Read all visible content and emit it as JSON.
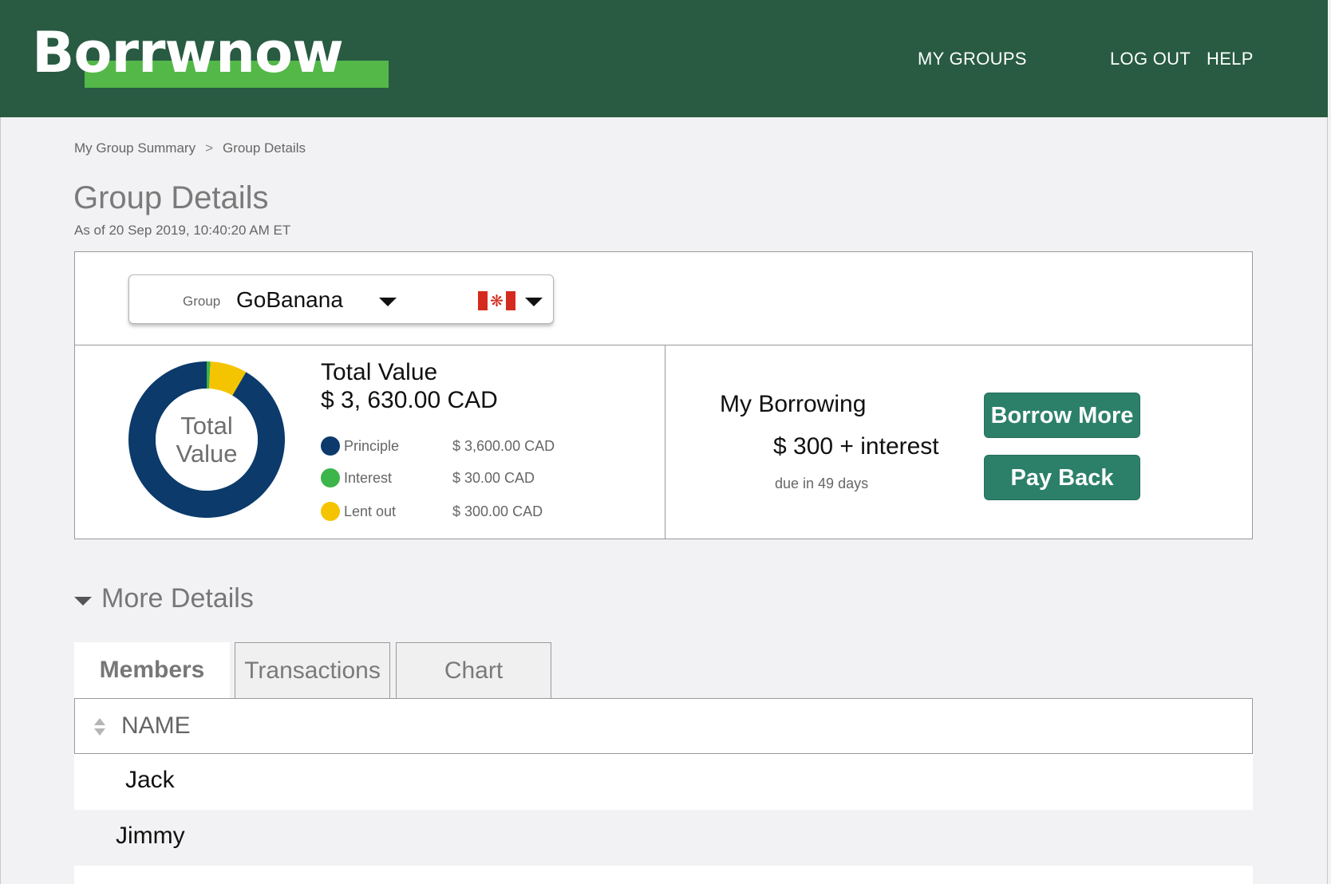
{
  "app": {
    "logo_text": "Borrwnow"
  },
  "nav": {
    "my_groups": "MY GROUPS",
    "log_out": "LOG OUT",
    "help": "HELP"
  },
  "breadcrumb": {
    "items": [
      "My Group Summary",
      "Group Details"
    ],
    "separator": ">"
  },
  "page": {
    "title": "Group Details",
    "timestamp": "As of 20 Sep 2019, 10:40:20 AM ET"
  },
  "group_selector": {
    "label": "Group",
    "value": "GoBanana",
    "country_flag": "canada-flag-icon"
  },
  "total_value": {
    "title": "Total Value",
    "amount": "$ 3, 630.00 CAD",
    "center_line1": "Total",
    "center_line2": "Value",
    "legend": [
      {
        "label": "Principle",
        "value": "$ 3,600.00 CAD",
        "color": "#0b3a6b"
      },
      {
        "label": "Interest",
        "value": "$ 30.00 CAD",
        "color": "#3cb54a"
      },
      {
        "label": "Lent out",
        "value": "$ 300.00 CAD",
        "color": "#f5c400"
      }
    ]
  },
  "chart_data": {
    "type": "pie",
    "categories": [
      "Interest",
      "Lent out",
      "Principle"
    ],
    "values": [
      30,
      300,
      3600
    ],
    "colors": [
      "#3cb54a",
      "#f5c400",
      "#0b3a6b"
    ],
    "style": "donut"
  },
  "borrowing": {
    "title": "My Borrowing",
    "amount": "$ 300 + interest",
    "due": "due in 49 days",
    "borrow_more_label": "Borrow More",
    "pay_back_label": "Pay Back"
  },
  "more_details": {
    "label": "More Details",
    "tabs": [
      "Members",
      "Transactions",
      "Chart"
    ],
    "active_tab": "Members"
  },
  "members_table": {
    "column_header": "NAME",
    "rows": [
      "Jack",
      "Jimmy"
    ]
  },
  "colors": {
    "header_bg": "#285b42",
    "logo_accent": "#54b848",
    "button_bg": "#2c8069",
    "principle": "#0b3a6b",
    "interest": "#3cb54a",
    "lent_out": "#f5c400"
  }
}
